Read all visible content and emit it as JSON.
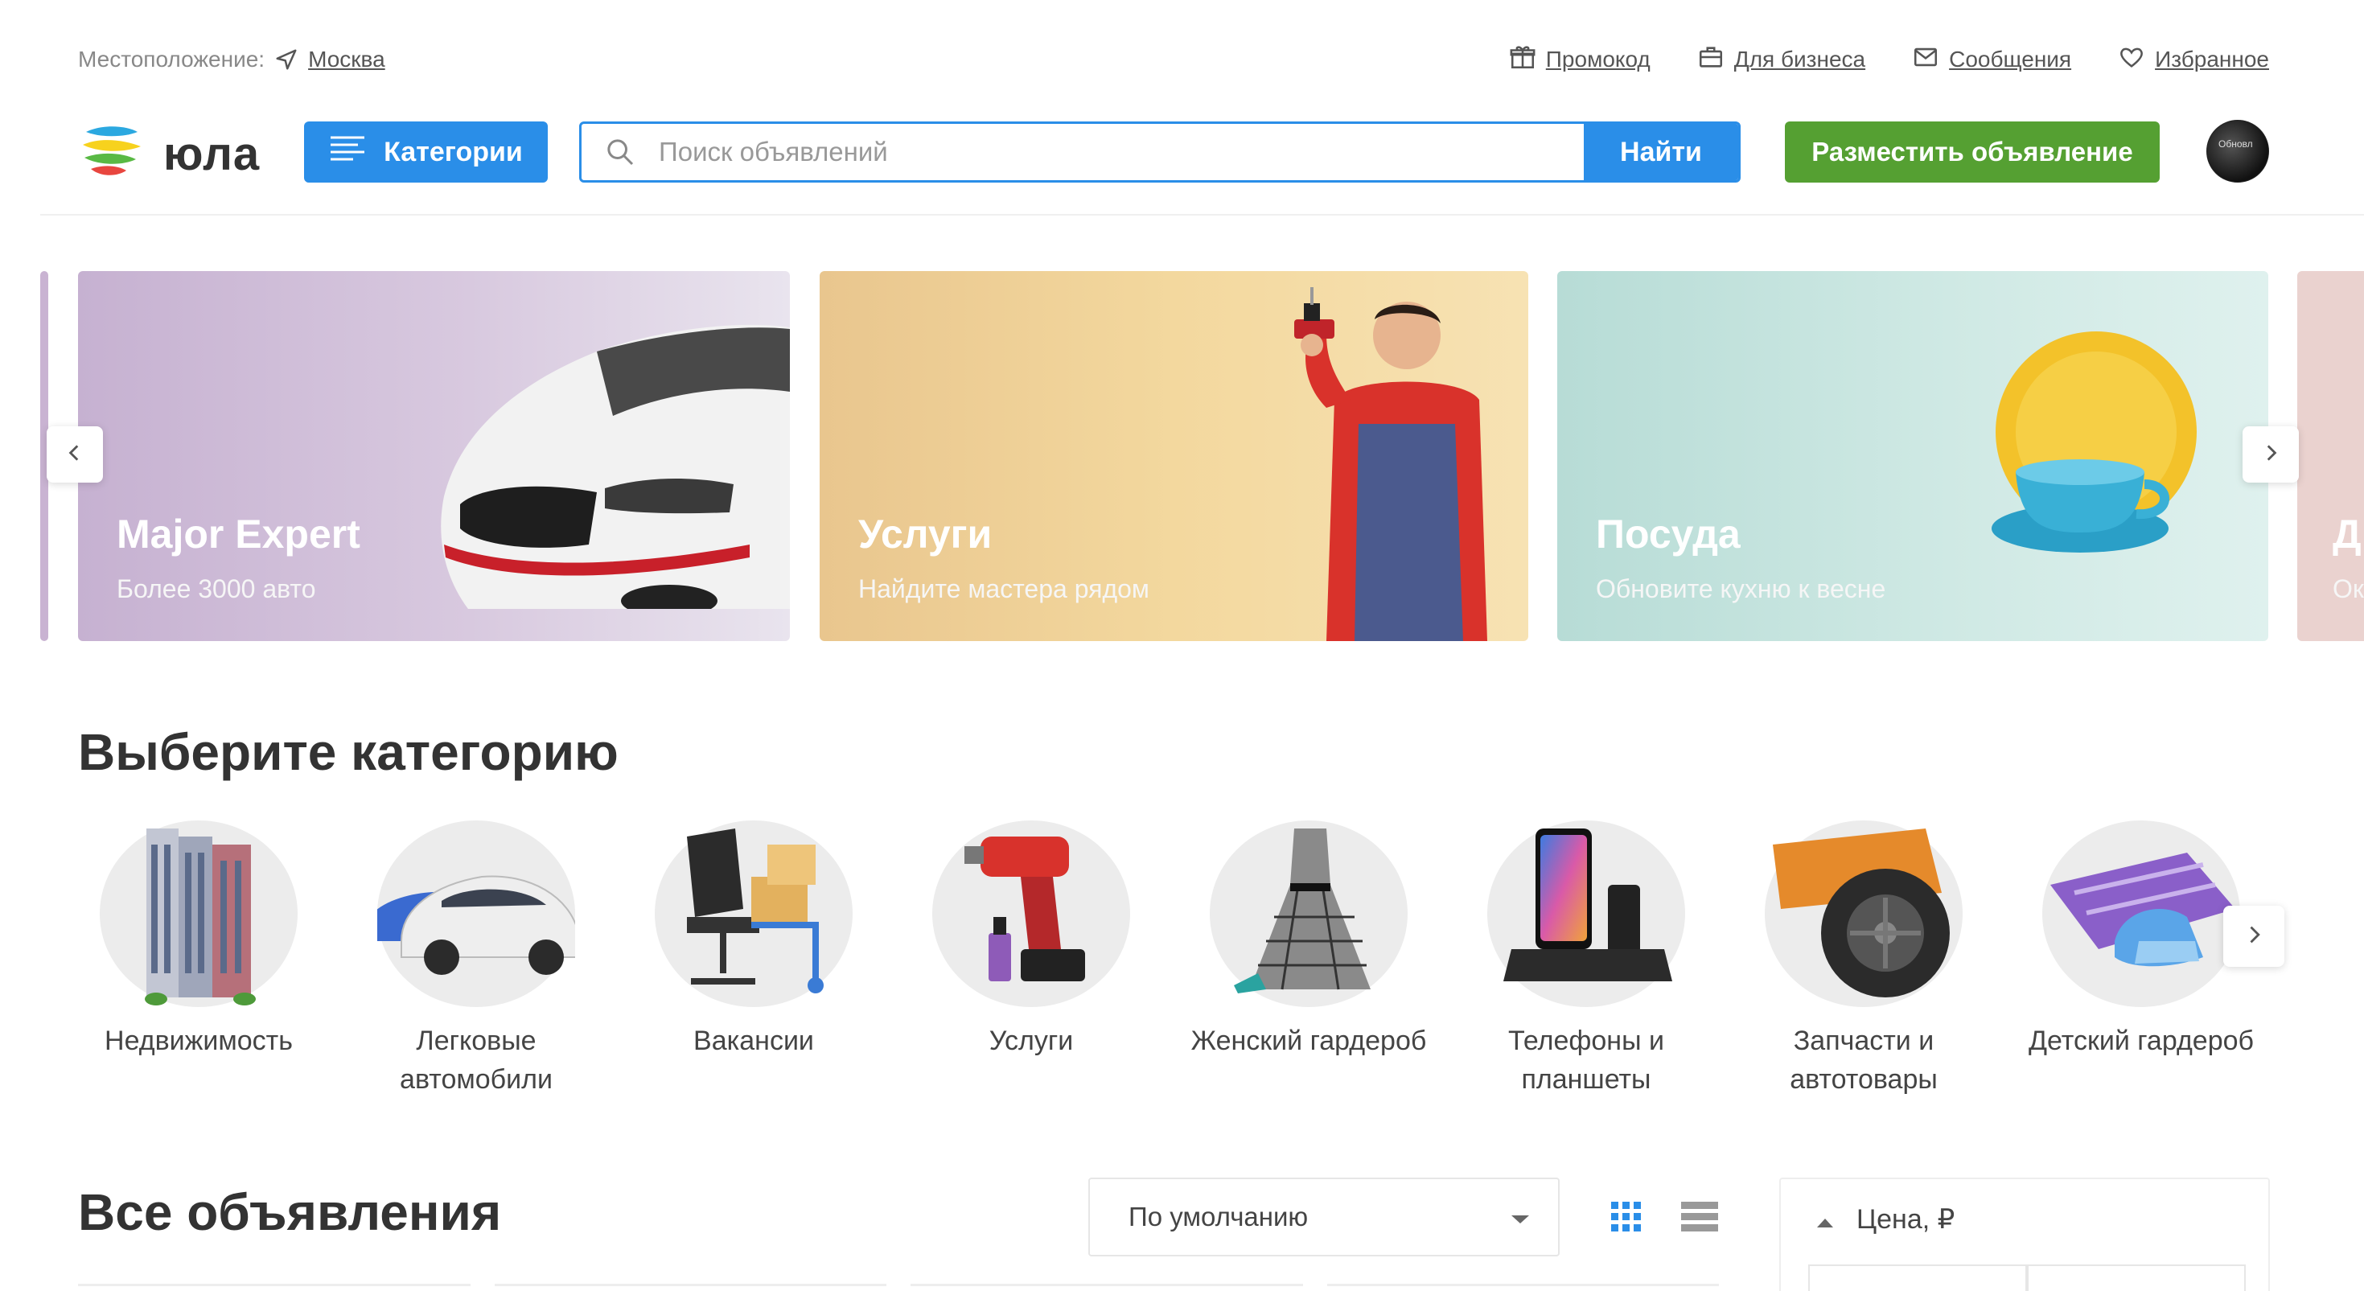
{
  "topbar": {
    "location_label": "Местоположение:",
    "city": "Москва",
    "links": [
      {
        "icon": "gift-icon",
        "label": "Промокод"
      },
      {
        "icon": "briefcase-icon",
        "label": "Для бизнеса"
      },
      {
        "icon": "envelope-icon",
        "label": "Сообщения"
      },
      {
        "icon": "heart-icon",
        "label": "Избранное"
      }
    ]
  },
  "header": {
    "logo_text": "юла",
    "categories_button": "Категории",
    "search_placeholder": "Поиск объявлений",
    "search_button": "Найти",
    "post_button": "Разместить объявление",
    "avatar_text": "Обновл",
    "colors": {
      "primary_blue": "#2a8ee8",
      "post_green": "#55a032"
    }
  },
  "banners": [
    {
      "title": "Major Expert",
      "subtitle": "Более 3000 авто"
    },
    {
      "title": "Услуги",
      "subtitle": "Найдите мастера рядом"
    },
    {
      "title": "Посуда",
      "subtitle": "Обновите кухню к весне"
    },
    {
      "title": "Д",
      "subtitle": "Ок"
    }
  ],
  "categories_section": {
    "title": "Выберите категорию",
    "items": [
      {
        "label": "Недвижимость"
      },
      {
        "label": "Легковые автомобили"
      },
      {
        "label": "Вакансии"
      },
      {
        "label": "Услуги"
      },
      {
        "label": "Женский гардероб"
      },
      {
        "label": "Телефоны и планшеты"
      },
      {
        "label": "Запчасти и автотовары"
      },
      {
        "label": "Детский гардероб"
      }
    ]
  },
  "listings_section": {
    "title": "Все объявления",
    "sort_value": "По умолчанию",
    "filter_price_label": "Цена, ₽"
  }
}
